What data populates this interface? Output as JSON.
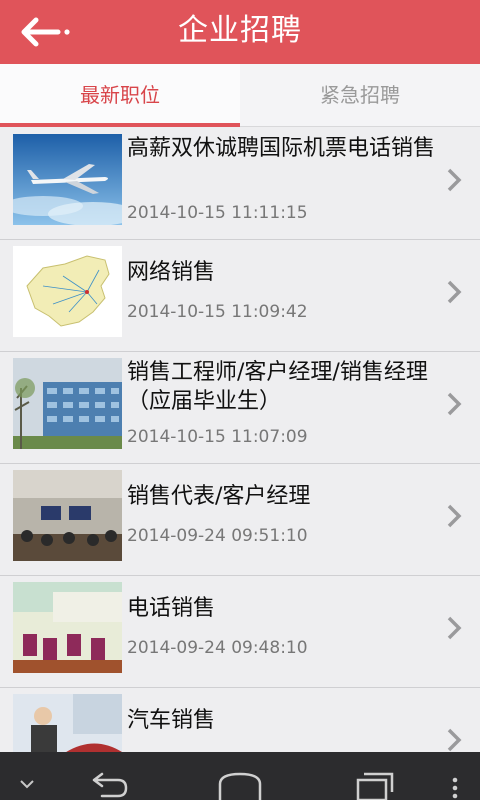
{
  "header": {
    "title": "企业招聘",
    "back_icon": "back-arrow-icon"
  },
  "tabs": [
    {
      "label": "最新职位",
      "active": true
    },
    {
      "label": "紧急招聘",
      "active": false
    }
  ],
  "jobs": [
    {
      "title": "高薪双休诚聘国际机票电话销售",
      "date": "2014-10-15 11:11:15",
      "image": "airplane-photo"
    },
    {
      "title": "网络销售",
      "date": "2014-10-15 11:09:42",
      "image": "china-map-photo"
    },
    {
      "title": "销售工程师/客户经理/销售经理（应届毕业生）",
      "date": "2014-10-15 11:07:09",
      "image": "office-building-photo"
    },
    {
      "title": "销售代表/客户经理",
      "date": "2014-09-24 09:51:10",
      "image": "meeting-room-photo"
    },
    {
      "title": "电话销售",
      "date": "2014-09-24 09:48:10",
      "image": "restaurant-photo"
    },
    {
      "title": "汽车销售",
      "date": "",
      "image": "car-showroom-photo"
    }
  ],
  "colors": {
    "accent": "#e0545a",
    "active_tab_text": "#d8454a",
    "inactive_tab_text": "#9a9a9a"
  },
  "navbar": {
    "icons": [
      "chevron-down-icon",
      "back-icon",
      "home-icon",
      "recent-apps-icon",
      "menu-dots-icon"
    ]
  }
}
